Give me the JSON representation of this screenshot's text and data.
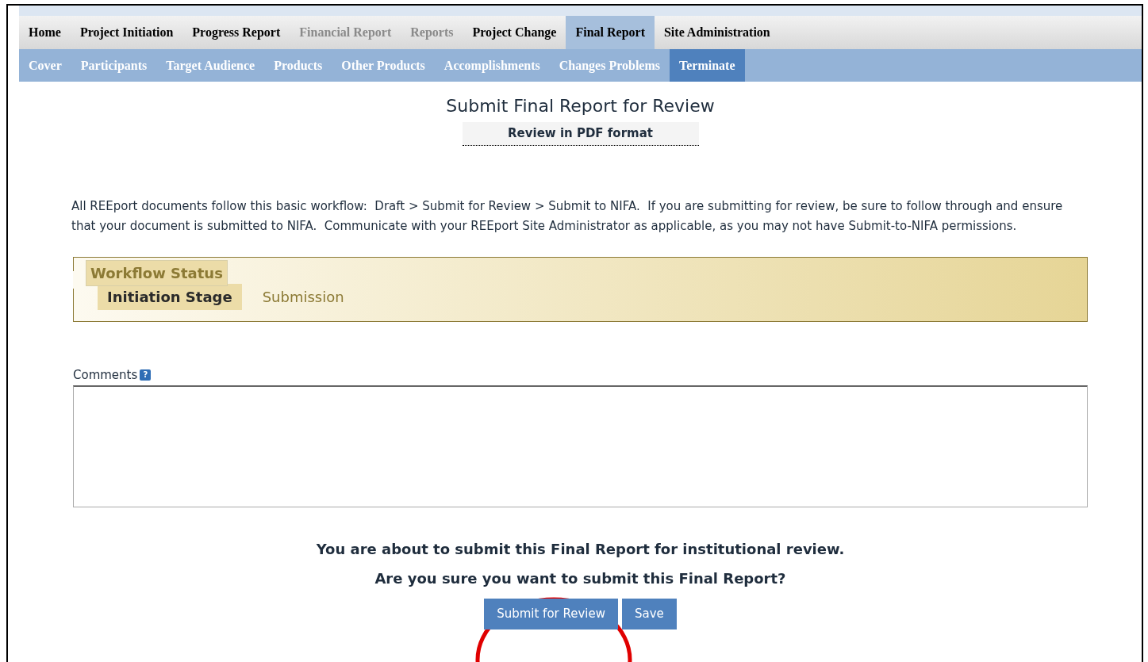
{
  "main_nav": [
    {
      "label": "Home",
      "selected": false,
      "disabled": false
    },
    {
      "label": "Project Initiation",
      "selected": false,
      "disabled": false
    },
    {
      "label": "Progress Report",
      "selected": false,
      "disabled": false
    },
    {
      "label": "Financial Report",
      "selected": false,
      "disabled": true
    },
    {
      "label": "Reports",
      "selected": false,
      "disabled": true
    },
    {
      "label": "Project Change",
      "selected": false,
      "disabled": false
    },
    {
      "label": "Final Report",
      "selected": true,
      "disabled": false
    },
    {
      "label": "Site Administration",
      "selected": false,
      "disabled": false
    }
  ],
  "sub_nav": [
    {
      "label": "Cover",
      "selected": false
    },
    {
      "label": "Participants",
      "selected": false
    },
    {
      "label": "Target Audience",
      "selected": false
    },
    {
      "label": "Products",
      "selected": false
    },
    {
      "label": "Other Products",
      "selected": false
    },
    {
      "label": "Accomplishments",
      "selected": false
    },
    {
      "label": "Changes Problems",
      "selected": false
    },
    {
      "label": "Terminate",
      "selected": true
    }
  ],
  "page_title": "Submit Final Report for Review",
  "pdf_link": "Review in PDF format",
  "intro": "All REEport documents follow this basic workflow:  Draft > Submit for Review > Submit to NIFA.  If you are submitting for review, be sure to follow through and ensure that your document is submitted to NIFA.  Communicate with your REEport Site Administrator as applicable, as you may not have Submit-to-NIFA permissions.",
  "workflow": {
    "legend": "Workflow Status",
    "stages": [
      {
        "label": "Initiation Stage",
        "selected": true
      },
      {
        "label": "Submission",
        "selected": false
      }
    ]
  },
  "comments": {
    "label": "Comments",
    "help": "?"
  },
  "confirm": [
    "You are about to submit this Final Report for institutional review.",
    "Are you sure you want to submit this Final Report?"
  ],
  "buttons": [
    "Submit for Review",
    "Save"
  ],
  "annotation": {
    "highlight": true
  }
}
